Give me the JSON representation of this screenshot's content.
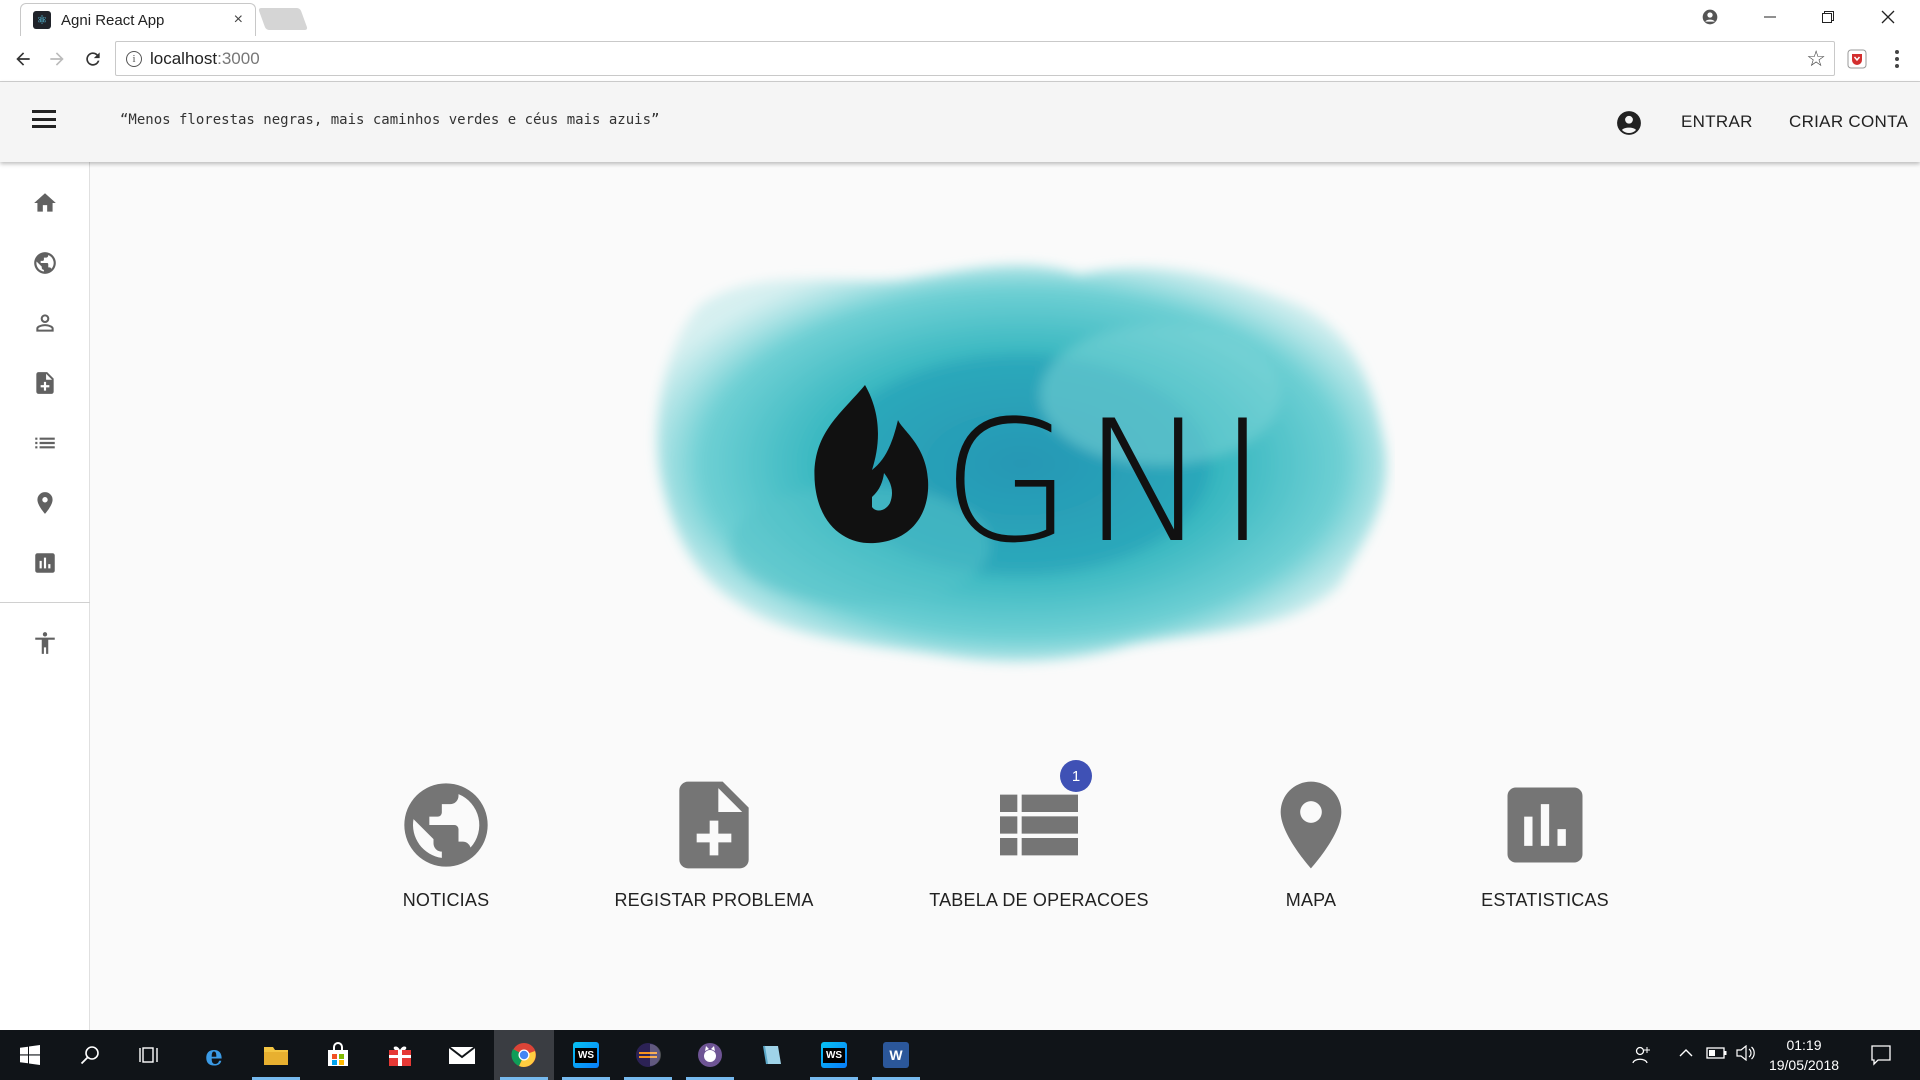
{
  "browser": {
    "tab_title": "Agni React App",
    "tab_close": "×",
    "url_host": "localhost",
    "url_port": ":3000"
  },
  "appbar": {
    "tagline": "“Menos florestas negras, mais caminhos verdes e céus mais azuis”",
    "login_label": "ENTRAR",
    "signup_label": "CRIAR CONTA"
  },
  "sidebar": {
    "items": [
      {
        "icon": "home-icon"
      },
      {
        "icon": "globe-icon"
      },
      {
        "icon": "person-icon"
      },
      {
        "icon": "note-add-icon"
      },
      {
        "icon": "list-icon"
      },
      {
        "icon": "location-pin-icon"
      },
      {
        "icon": "bar-chart-icon"
      },
      {
        "icon": "accessibility-icon"
      }
    ]
  },
  "logo": {
    "text": "GNI",
    "colors": {
      "cloud": "#2fb3bd",
      "ink": "#111111"
    }
  },
  "features": [
    {
      "label": "NOTICIAS",
      "icon": "globe-icon"
    },
    {
      "label": "REGISTAR PROBLEMA",
      "icon": "note-add-icon"
    },
    {
      "label": "TABELA DE OPERACOES",
      "icon": "list-icon",
      "badge": "1"
    },
    {
      "label": "MAPA",
      "icon": "location-pin-icon"
    },
    {
      "label": "ESTATISTICAS",
      "icon": "bar-chart-icon"
    }
  ],
  "taskbar": {
    "time": "01:19",
    "date": "19/05/2018"
  },
  "colors": {
    "badge": "#3f51b5",
    "icon_grey": "#757575",
    "sidebar_icon": "#616161"
  }
}
